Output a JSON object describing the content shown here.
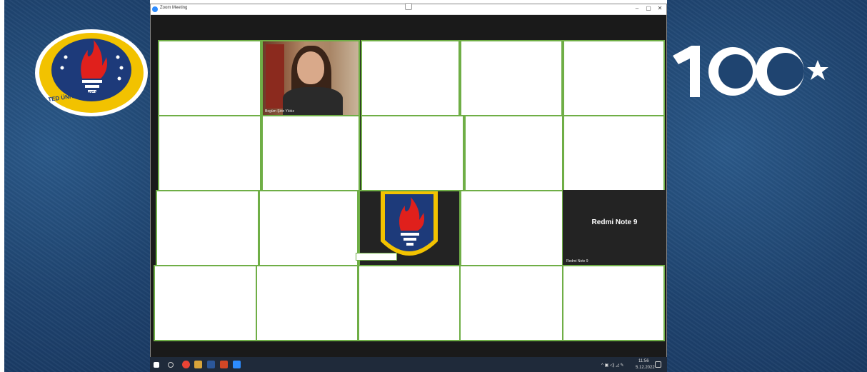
{
  "window": {
    "title": "Zoom Meeting",
    "min_glyph": "–",
    "max_glyph": "▢",
    "close_glyph": "✕"
  },
  "participants": {
    "video_tile_name": "Begüm Şirin Yıldız",
    "redmi_title": "Redmi Note 9",
    "redmi_label": "Redmi Note 9"
  },
  "logos": {
    "ted_text": "TED ÜNİVERSİTESİ",
    "centennial_text": "100"
  },
  "taskbar": {
    "time": "11:56",
    "date": "5.12.2022"
  },
  "colors": {
    "tile_border": "#6fae46",
    "background_blue": "#1f4470"
  }
}
